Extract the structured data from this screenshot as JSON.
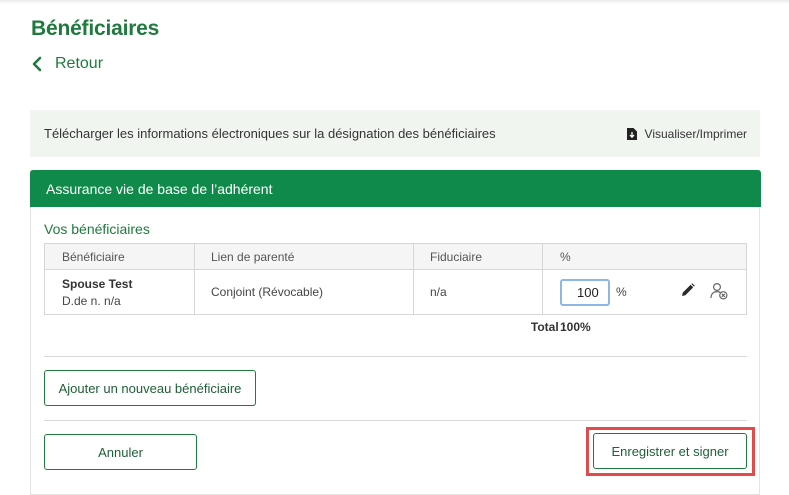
{
  "page": {
    "title": "Bénéficiaires",
    "back_label": "Retour"
  },
  "download": {
    "text": "Télécharger les informations électroniques sur la désignation des bénéficiaires",
    "print_label": "Visualiser/Imprimer"
  },
  "section": {
    "header": "Assurance vie de base de l’adhérent",
    "subtitle": "Vos bénéficiaires"
  },
  "table": {
    "columns": [
      "Bénéficiaire",
      "Lien de parenté",
      "Fiduciaire",
      "%"
    ],
    "rows": [
      {
        "name": "Spouse Test",
        "dob": "D.de n. n/a",
        "relationship": "Conjoint (Révocable)",
        "trustee": "n/a",
        "percent": "100",
        "percent_sign": "%"
      }
    ],
    "total_label": "Total :",
    "total_value": "100%"
  },
  "buttons": {
    "add": "Ajouter un nouveau bénéficiaire",
    "cancel": "Annuler",
    "save": "Enregistrer et signer"
  },
  "icons": {
    "back": "chevron-left-icon",
    "print": "file-download-icon",
    "edit": "pencil-icon",
    "remove": "remove-user-icon"
  },
  "colors": {
    "brand_green": "#1f7a3d",
    "header_green": "#0f8a4a",
    "highlight_red": "#e34a4a",
    "input_focus_blue": "#8cb7e6"
  }
}
